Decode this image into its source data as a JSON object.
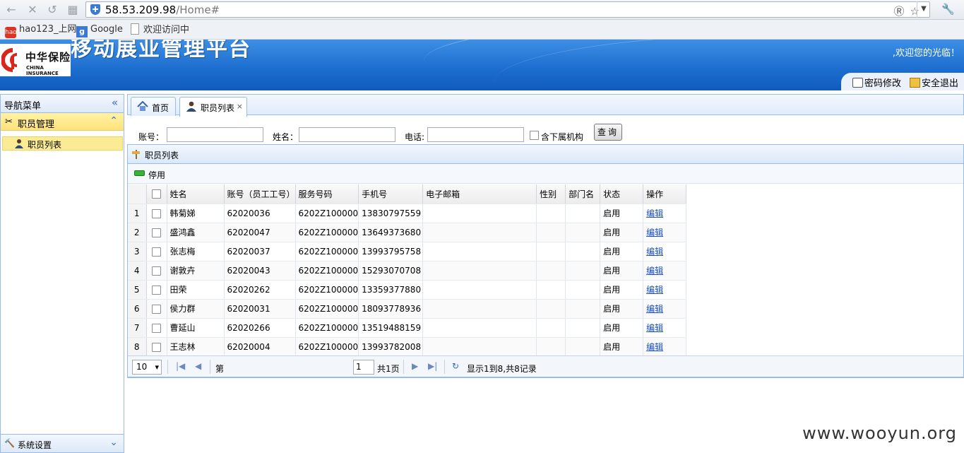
{
  "browser": {
    "url_host": "58.53.209.98",
    "url_path": "/Home#",
    "bookmarks": [
      "hao123_上网",
      "Google",
      "欢迎访问中"
    ]
  },
  "header": {
    "logo_cn": "中华保险",
    "logo_en": "CHINA INSURANCE",
    "system_title": "移动展业管理平台",
    "welcome": ",欢迎您的光临！",
    "change_password": "密码修改",
    "logout": "安全退出"
  },
  "nav": {
    "title": "导航菜单",
    "group": "职员管理",
    "item": "职员列表",
    "footer_group": "系统设置"
  },
  "tabs": [
    {
      "label": "首页"
    },
    {
      "label": "职员列表"
    }
  ],
  "search": {
    "account_label": "账号：",
    "name_label": "姓名：",
    "phone_label": "电话:",
    "include_sub_label": "含下属机构",
    "query_button": "查询"
  },
  "grid": {
    "title": "职员列表",
    "toolbar_disable": "停用",
    "columns": [
      "姓名",
      "账号（员工工号）",
      "服务号码",
      "手机号",
      "电子邮箱",
      "性别",
      "部门名",
      "状态",
      "操作"
    ],
    "rows": [
      {
        "n": "1",
        "name": "韩菊娣",
        "account": "62020036",
        "service": "6202Z100000",
        "mobile": "13830797559",
        "email": "",
        "gender": "",
        "dept": "",
        "status": "启用",
        "op": "编辑"
      },
      {
        "n": "2",
        "name": "盛鸿鑫",
        "account": "62020047",
        "service": "6202Z100000",
        "mobile": "13649373680",
        "email": "",
        "gender": "",
        "dept": "",
        "status": "启用",
        "op": "编辑"
      },
      {
        "n": "3",
        "name": "张志梅",
        "account": "62020037",
        "service": "6202Z100000",
        "mobile": "13993795758",
        "email": "",
        "gender": "",
        "dept": "",
        "status": "启用",
        "op": "编辑"
      },
      {
        "n": "4",
        "name": "谢敦卉",
        "account": "62020043",
        "service": "6202Z100000",
        "mobile": "15293070708",
        "email": "",
        "gender": "",
        "dept": "",
        "status": "启用",
        "op": "编辑"
      },
      {
        "n": "5",
        "name": "田荣",
        "account": "62020262",
        "service": "6202Z100000",
        "mobile": "13359377880",
        "email": "",
        "gender": "",
        "dept": "",
        "status": "启用",
        "op": "编辑"
      },
      {
        "n": "6",
        "name": "侯力群",
        "account": "62020031",
        "service": "6202Z100000",
        "mobile": "18093778936",
        "email": "",
        "gender": "",
        "dept": "",
        "status": "启用",
        "op": "编辑"
      },
      {
        "n": "7",
        "name": "曹延山",
        "account": "62020266",
        "service": "6202Z100000",
        "mobile": "13519488159",
        "email": "",
        "gender": "",
        "dept": "",
        "status": "启用",
        "op": "编辑"
      },
      {
        "n": "8",
        "name": "王志林",
        "account": "62020004",
        "service": "6202Z100000",
        "mobile": "13993782008",
        "email": "",
        "gender": "",
        "dept": "",
        "status": "启用",
        "op": "编辑"
      }
    ]
  },
  "pager": {
    "page_size": "10",
    "page_prefix": "第",
    "current_page": "1",
    "page_suffix": "共1页",
    "summary": "显示1到8,共8记录"
  },
  "watermark": "www.wooyun.org"
}
